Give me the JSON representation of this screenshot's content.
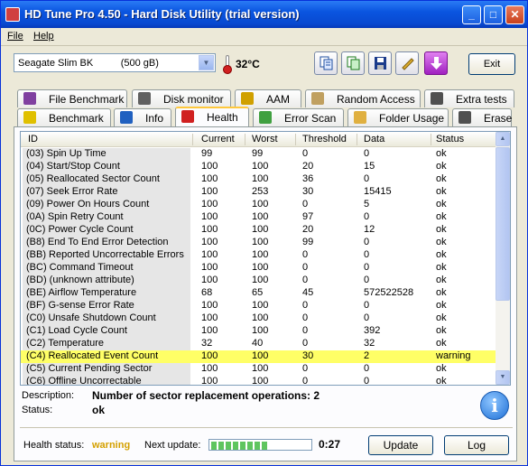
{
  "window": {
    "title": "HD Tune Pro 4.50 - Hard Disk Utility (trial version)"
  },
  "menu": {
    "file": "File",
    "help": "Help"
  },
  "toolbar": {
    "drive": "Seagate Slim BK          (500 gB)",
    "temperature": "32°C",
    "exit_label": "Exit"
  },
  "tabs_top": [
    {
      "label": "File Benchmark",
      "icon": "file-benchmark-icon"
    },
    {
      "label": "Disk monitor",
      "icon": "disk-monitor-icon"
    },
    {
      "label": "AAM",
      "icon": "speaker-icon"
    },
    {
      "label": "Random Access",
      "icon": "random-access-icon"
    },
    {
      "label": "Extra tests",
      "icon": "extra-tests-icon"
    }
  ],
  "tabs_bottom": [
    {
      "label": "Benchmark",
      "icon": "benchmark-icon"
    },
    {
      "label": "Info",
      "icon": "info-icon"
    },
    {
      "label": "Health",
      "icon": "health-cross-icon",
      "active": true
    },
    {
      "label": "Error Scan",
      "icon": "magnifier-icon"
    },
    {
      "label": "Folder Usage",
      "icon": "folder-icon"
    },
    {
      "label": "Erase",
      "icon": "trash-icon"
    }
  ],
  "grid": {
    "headers": [
      "ID",
      "Current",
      "Worst",
      "Threshold",
      "Data",
      "Status"
    ],
    "rows": [
      [
        "(03) Spin Up Time",
        "99",
        "99",
        "0",
        "0",
        "ok"
      ],
      [
        "(04) Start/Stop Count",
        "100",
        "100",
        "20",
        "15",
        "ok"
      ],
      [
        "(05) Reallocated Sector Count",
        "100",
        "100",
        "36",
        "0",
        "ok"
      ],
      [
        "(07) Seek Error Rate",
        "100",
        "253",
        "30",
        "15415",
        "ok"
      ],
      [
        "(09) Power On Hours Count",
        "100",
        "100",
        "0",
        "5",
        "ok"
      ],
      [
        "(0A) Spin Retry Count",
        "100",
        "100",
        "97",
        "0",
        "ok"
      ],
      [
        "(0C) Power Cycle Count",
        "100",
        "100",
        "20",
        "12",
        "ok"
      ],
      [
        "(B8) End To End Error Detection",
        "100",
        "100",
        "99",
        "0",
        "ok"
      ],
      [
        "(BB) Reported Uncorrectable Errors",
        "100",
        "100",
        "0",
        "0",
        "ok"
      ],
      [
        "(BC) Command Timeout",
        "100",
        "100",
        "0",
        "0",
        "ok"
      ],
      [
        "(BD) (unknown attribute)",
        "100",
        "100",
        "0",
        "0",
        "ok"
      ],
      [
        "(BE) Airflow Temperature",
        "68",
        "65",
        "45",
        "572522528",
        "ok"
      ],
      [
        "(BF) G-sense Error Rate",
        "100",
        "100",
        "0",
        "0",
        "ok"
      ],
      [
        "(C0) Unsafe Shutdown Count",
        "100",
        "100",
        "0",
        "0",
        "ok"
      ],
      [
        "(C1) Load Cycle Count",
        "100",
        "100",
        "0",
        "392",
        "ok"
      ],
      [
        "(C2) Temperature",
        "32",
        "40",
        "0",
        "32",
        "ok"
      ],
      [
        "(C4) Reallocated Event Count",
        "100",
        "100",
        "30",
        "2",
        "warning"
      ],
      [
        "(C5) Current Pending Sector",
        "100",
        "100",
        "0",
        "0",
        "ok"
      ],
      [
        "(C6) Offline Uncorrectable",
        "100",
        "100",
        "0",
        "0",
        "ok"
      ]
    ],
    "highlight_color": "#ffff66"
  },
  "detail": {
    "description_label": "Description:",
    "description_value": "Number of sector replacement operations: 2",
    "status_label": "Status:",
    "status_value": "ok"
  },
  "footer": {
    "health_label": "Health status:",
    "health_value": "warning",
    "health_color": "#d4a000",
    "next_update_label": "Next update:",
    "progress_fraction": 0.6,
    "timer": "0:27",
    "update_label": "Update",
    "log_label": "Log"
  }
}
